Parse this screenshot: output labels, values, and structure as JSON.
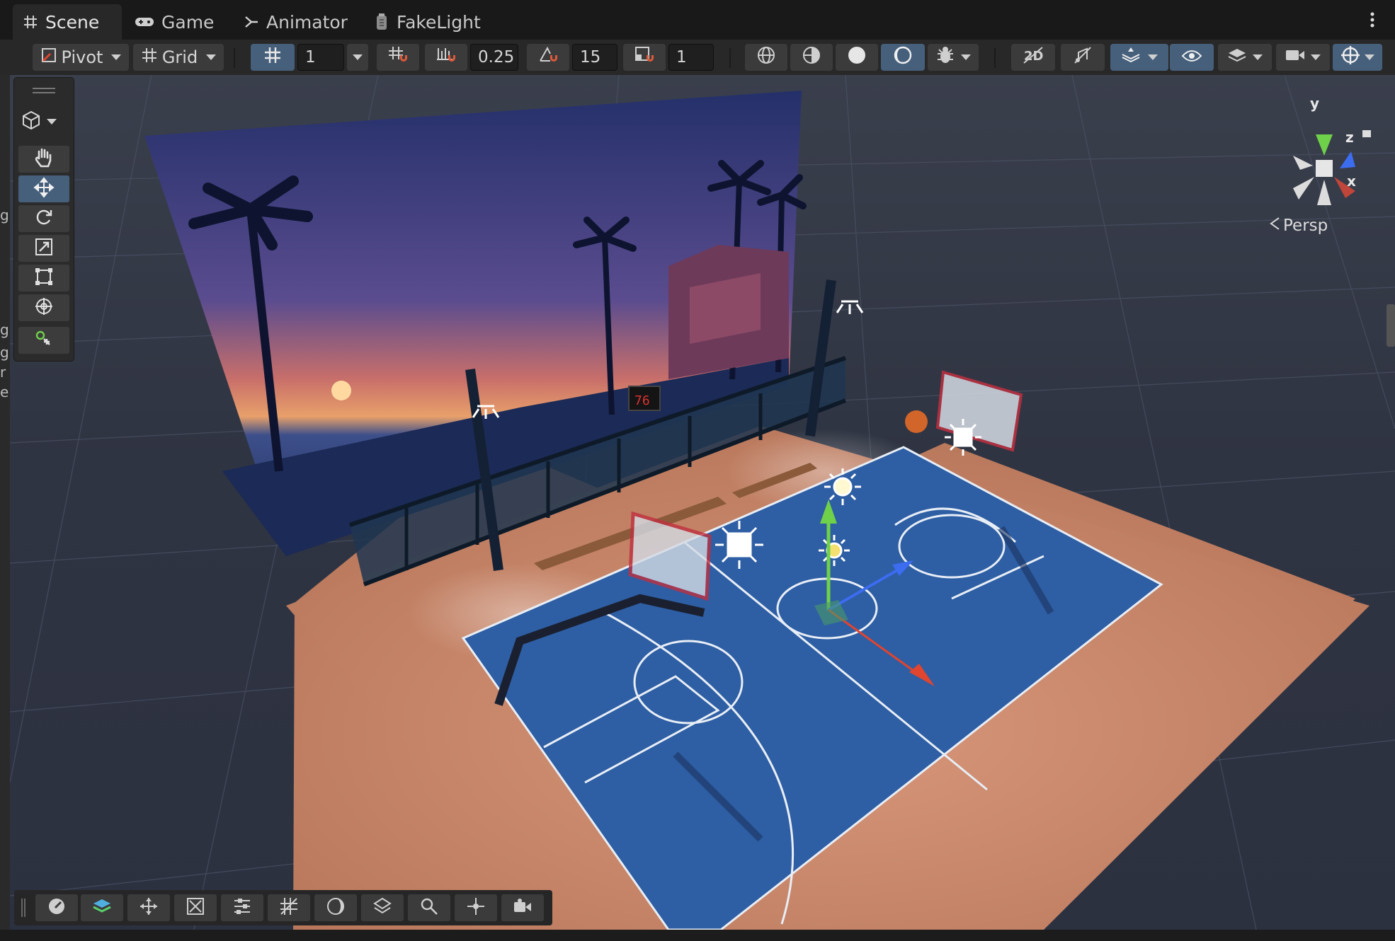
{
  "tabs": [
    {
      "label": "Scene",
      "icon": "grid-hash-icon",
      "active": true
    },
    {
      "label": "Game",
      "icon": "gamepad-icon",
      "active": false
    },
    {
      "label": "Animator",
      "icon": "animator-icon",
      "active": false
    },
    {
      "label": "FakeLight",
      "icon": "lantern-icon",
      "active": false
    }
  ],
  "toolbar": {
    "pivot_label": "Pivot",
    "grid_label": "Grid",
    "grid_size_value": "1",
    "move_snap_value": "0.25",
    "rotate_snap_value": "15",
    "scale_snap_value": "1"
  },
  "scene": {
    "projection_label": "Persp",
    "axes": {
      "x": "x",
      "y": "y",
      "z": "z"
    },
    "scoreboard_text": "76"
  },
  "left_edge_fragments": [
    "gl",
    "gl",
    "gl",
    "r",
    "e"
  ],
  "tools": [
    "hand-tool",
    "move-tool",
    "rotate-tool",
    "scale-tool",
    "rect-tool",
    "transform-tool",
    "custom-tool"
  ],
  "overlay_tools": [
    "orientation-icon",
    "layers-icon",
    "move-icon",
    "scale-icon",
    "sliders-icon",
    "grid-snap-icon",
    "light-probe-icon",
    "mesh-icon",
    "search-icon",
    "navigation-icon",
    "camera-icon"
  ],
  "colors": {
    "accent_selected": "#46607c",
    "court_blue": "#2e5ea3",
    "court_sand": "#c8896a",
    "axis_x": "#e0452f",
    "axis_y": "#6fd14a",
    "axis_z": "#3c6cf0"
  }
}
